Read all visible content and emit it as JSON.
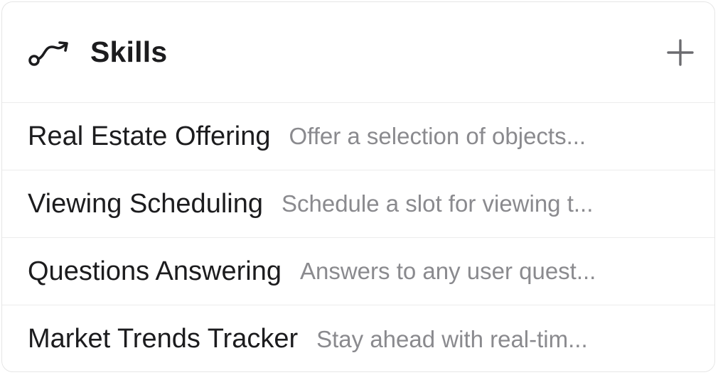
{
  "panel": {
    "title": "Skills",
    "icon": "skills-curve-arrow-icon",
    "add_icon": "plus-icon"
  },
  "skills": [
    {
      "name": "Real Estate Offering",
      "description": "Offer a selection of objects..."
    },
    {
      "name": "Viewing Scheduling",
      "description": "Schedule a slot for viewing t..."
    },
    {
      "name": "Questions Answering",
      "description": "Answers to any user quest..."
    },
    {
      "name": "Market Trends Tracker",
      "description": "Stay ahead with real-tim..."
    }
  ],
  "colors": {
    "text_primary": "#1c1c1e",
    "text_secondary": "#8a8a8e",
    "divider": "#ececec"
  }
}
